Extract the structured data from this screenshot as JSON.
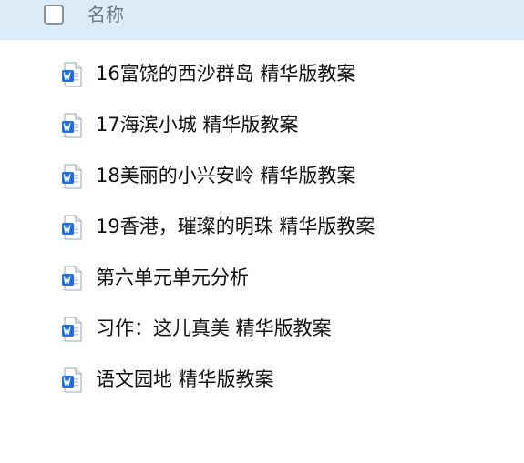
{
  "header": {
    "select_all_checked": false,
    "column_label": "名称"
  },
  "files": [
    {
      "name": "16富饶的西沙群岛 精华版教案",
      "icon": "word-doc-icon"
    },
    {
      "name": "17海滨小城 精华版教案",
      "icon": "word-doc-icon"
    },
    {
      "name": "18美丽的小兴安岭 精华版教案",
      "icon": "word-doc-icon"
    },
    {
      "name": "19香港，璀璨的明珠 精华版教案",
      "icon": "word-doc-icon"
    },
    {
      "name": "第六单元单元分析",
      "icon": "word-doc-icon"
    },
    {
      "name": "习作：这儿真美 精华版教案",
      "icon": "word-doc-icon"
    },
    {
      "name": "语文园地 精华版教案",
      "icon": "word-doc-icon"
    }
  ],
  "colors": {
    "header_background": "#dcebf8",
    "word_blue": "#1f6fe0",
    "text": "#111111",
    "header_text": "#6b7787"
  }
}
